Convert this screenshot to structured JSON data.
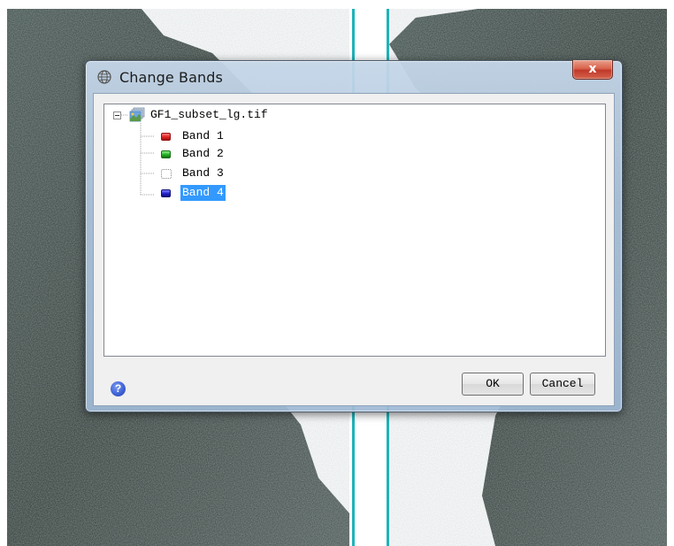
{
  "dialog": {
    "title": "Change Bands",
    "close_label": "x",
    "icon": "globe-icon"
  },
  "tree": {
    "root": {
      "label": "GF1_subset_lg.tif",
      "icon": "raster-file-icon",
      "expanded": true
    },
    "bands": [
      {
        "label": "Band 1",
        "color": "#e02020",
        "selected": false
      },
      {
        "label": "Band 2",
        "color": "#22b022",
        "selected": false
      },
      {
        "label": "Band 3",
        "color": "none",
        "selected": false
      },
      {
        "label": "Band 4",
        "color": "#2020c8",
        "selected": true
      }
    ]
  },
  "footer": {
    "help_label": "?",
    "ok_label": "OK",
    "cancel_label": "Cancel"
  },
  "colors": {
    "selection": "#3399ff",
    "close_button": "#c0392b",
    "help": "#3f63d6"
  }
}
